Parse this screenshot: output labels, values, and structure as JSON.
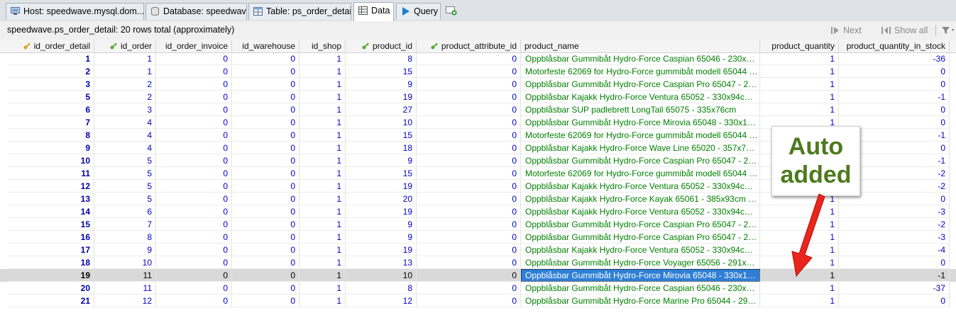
{
  "tabs": [
    {
      "label": "Host: speedwave.mysql.dom...",
      "icon": "host-icon"
    },
    {
      "label": "Database: speedwave",
      "icon": "database-icon"
    },
    {
      "label": "Table: ps_order_detail",
      "icon": "table-icon"
    },
    {
      "label": "Data",
      "icon": "data-grid-icon",
      "active": true
    },
    {
      "label": "Query",
      "icon": "play-icon"
    }
  ],
  "info": {
    "summary": "speedwave.ps_order_detail: 20 rows total (approximately)",
    "next_label": "Next",
    "show_all_label": "Show all"
  },
  "columns": [
    {
      "label": "id_order_detail",
      "key": "primary"
    },
    {
      "label": "id_order",
      "key": "foreign"
    },
    {
      "label": "id_order_invoice"
    },
    {
      "label": "id_warehouse"
    },
    {
      "label": "id_shop"
    },
    {
      "label": "product_id",
      "key": "foreign"
    },
    {
      "label": "product_attribute_id",
      "key": "foreign"
    },
    {
      "label": "product_name"
    },
    {
      "label": "product_quantity"
    },
    {
      "label": "product_quantity_in_stock"
    }
  ],
  "rows": [
    [
      "1",
      "1",
      "0",
      "0",
      "1",
      "8",
      "0",
      "Oppblåsbar Gummibåt Hydro-Force Caspian 65046 - 230x130cm ...",
      "1",
      "-36"
    ],
    [
      "2",
      "1",
      "0",
      "0",
      "1",
      "15",
      "0",
      "Motorfeste 62069 for Hydro-Force gummibåt modell 65044 og 65...",
      "1",
      "0"
    ],
    [
      "3",
      "2",
      "0",
      "0",
      "1",
      "9",
      "0",
      "Oppblåsbar Gummibåt Hydro-Force Caspian Pro 65047 - 280x15...",
      "1",
      "0"
    ],
    [
      "5",
      "2",
      "0",
      "0",
      "1",
      "19",
      "0",
      "Oppblåsbar Kajakk Hydro-Force Ventura 65052 - 330x94cm - 2 p...",
      "1",
      "-1"
    ],
    [
      "6",
      "3",
      "0",
      "0",
      "1",
      "27",
      "0",
      "Oppblåsbar SUP padlebrett LongTail 65075 - 335x76cm",
      "1",
      "0"
    ],
    [
      "7",
      "4",
      "0",
      "0",
      "1",
      "10",
      "0",
      "Oppblåsbar Gummibåt Hydro-Force Mirovia 65048 - 330x162cm - ...",
      "1",
      "0"
    ],
    [
      "8",
      "4",
      "0",
      "0",
      "1",
      "15",
      "0",
      "Motorfeste 62069 for Hydro-Force gummibåt modell 65044 og 65...",
      "1",
      "-1"
    ],
    [
      "9",
      "4",
      "0",
      "0",
      "1",
      "18",
      "0",
      "Oppblåsbar Kajakk Hydro-Force Wave Line 65020 - 357x77cm - ...",
      "1",
      "0"
    ],
    [
      "10",
      "5",
      "0",
      "0",
      "1",
      "9",
      "0",
      "Oppblåsbar Gummibåt Hydro-Force Caspian Pro 65047 - 280x15...",
      "1",
      "-1"
    ],
    [
      "11",
      "5",
      "0",
      "0",
      "1",
      "15",
      "0",
      "Motorfeste 62069 for Hydro-Force gummibåt modell 65044 og 65...",
      "1",
      "-2"
    ],
    [
      "12",
      "5",
      "0",
      "0",
      "1",
      "19",
      "0",
      "Oppblåsbar Kajakk Hydro-Force Ventura 65052 - 330x94cm - 2 p...",
      "1",
      "-2"
    ],
    [
      "13",
      "5",
      "0",
      "0",
      "1",
      "20",
      "0",
      "Oppblåsbar Kajakk Hydro-Force Kayak 65061 - 385x93cm - 2 pers",
      "1",
      "0"
    ],
    [
      "14",
      "6",
      "0",
      "0",
      "1",
      "19",
      "0",
      "Oppblåsbar Kajakk Hydro-Force Ventura 65052 - 330x94cm - 2 p...",
      "1",
      "-3"
    ],
    [
      "15",
      "7",
      "0",
      "0",
      "1",
      "9",
      "0",
      "Oppblåsbar Gummibåt Hydro-Force Caspian Pro 65047 - 280x15...",
      "1",
      "-2"
    ],
    [
      "16",
      "8",
      "0",
      "0",
      "1",
      "9",
      "0",
      "Oppblåsbar Gummibåt Hydro-Force Caspian Pro 65047 - 280x15...",
      "1",
      "-3"
    ],
    [
      "17",
      "9",
      "0",
      "0",
      "1",
      "19",
      "0",
      "Oppblåsbar Kajakk Hydro-Force Ventura 65052 - 330x94cm - 2 p...",
      "1",
      "-4"
    ],
    [
      "18",
      "10",
      "0",
      "0",
      "1",
      "13",
      "0",
      "Oppblåsbar Gummibåt Hydro-Force Voyager 65056 - 291x127cm ...",
      "1",
      "0"
    ],
    [
      "19",
      "11",
      "0",
      "0",
      "1",
      "10",
      "0",
      "Oppblåsbar Gummibåt Hydro-Force Mirovia 65048 - 330x162cm -...",
      "1",
      "-1"
    ],
    [
      "20",
      "11",
      "0",
      "0",
      "1",
      "8",
      "0",
      "Oppblåsbar Gummibåt Hydro-Force Caspian 65046 - 230x130cm -...",
      "1",
      "-37"
    ],
    [
      "21",
      "12",
      "0",
      "0",
      "1",
      "12",
      "0",
      "Oppblåsbar Gummibåt Hydro-Force Marine Pro 65044 - 291x127c...",
      "1",
      "0"
    ]
  ],
  "selected_row": 17,
  "annotation": {
    "line1": "Auto",
    "line2": "added",
    "color": "#4e7a1e",
    "arrow_color": "#e8261c"
  },
  "colors": {
    "id_text": "#0000cc",
    "name_text": "#008000",
    "selection": "#2f7fd6"
  }
}
